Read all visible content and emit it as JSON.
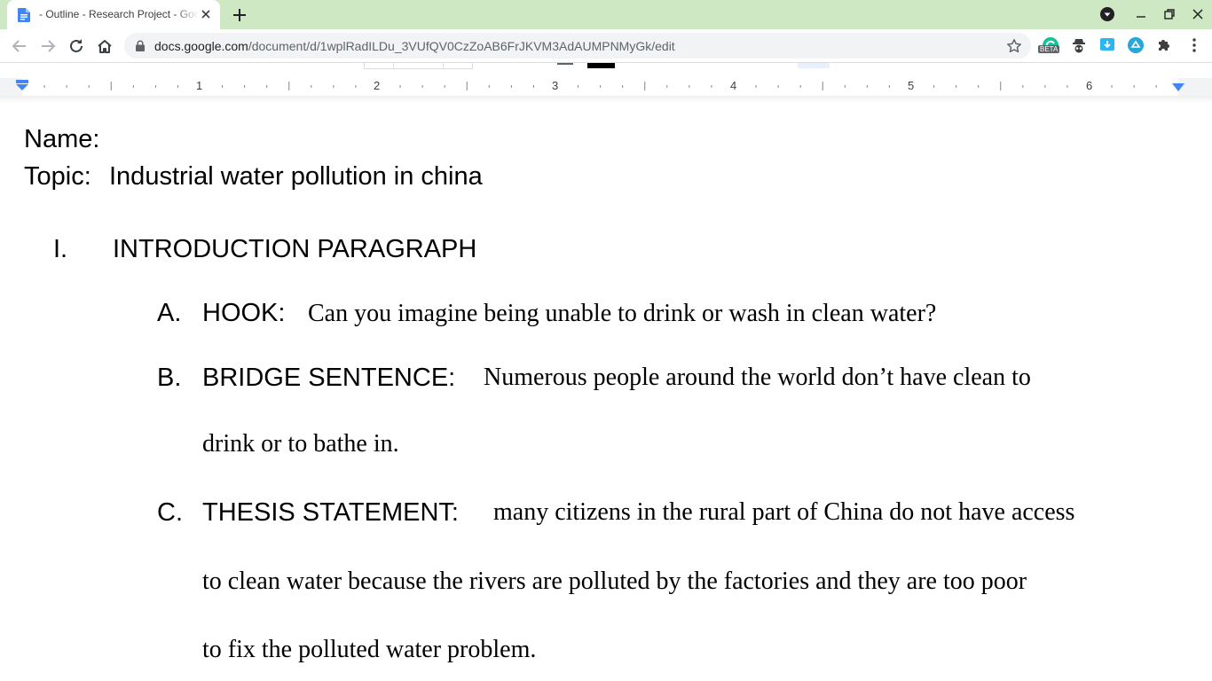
{
  "browser": {
    "tab_title": "- Outline - Research Project - Google Docs",
    "url_host": "docs.google.com",
    "url_path": "/document/d/1wplRadILDu_3VUfQV0CzZoAB6FrJKVM3AdAUMPNMyGk/edit",
    "extension_badge": "BETA"
  },
  "ruler": {
    "numbers": [
      "1",
      "2",
      "3",
      "4",
      "5",
      "6"
    ]
  },
  "document": {
    "name_label": "Name:",
    "topic_label": "Topic:",
    "topic_value": "Industrial water pollution in china",
    "section": {
      "numeral": "I.",
      "heading": "INTRODUCTION PARAGRAPH",
      "items": [
        {
          "letter": "A.",
          "label": "HOOK:",
          "lines": [
            "Can you imagine being unable to drink or wash in clean water?"
          ]
        },
        {
          "letter": "B.",
          "label": "BRIDGE SENTENCE:",
          "lines": [
            "Numerous people around the world don’t have clean to",
            "drink or to bathe in."
          ]
        },
        {
          "letter": "C.",
          "label": "THESIS STATEMENT:",
          "lines": [
            "many citizens in the rural part of China do not have access",
            "to clean water because the rivers are polluted by the factories and they are too poor",
            "to fix the polluted water problem."
          ]
        }
      ]
    }
  },
  "colors": {
    "tabstrip_bg": "#cde8c2",
    "docs_blue": "#4285f4",
    "omnibox_bg": "#f1f3f4"
  },
  "icons": [
    "docs-favicon-icon",
    "close-icon",
    "plus-icon",
    "profile-dropdown-icon",
    "minimize-icon",
    "restore-icon",
    "back-arrow-icon",
    "forward-arrow-icon",
    "reload-icon",
    "home-icon",
    "lock-icon",
    "star-icon",
    "extension-grammarly-icon",
    "extension-spy-icon",
    "extension-save-icon",
    "extension-circle-icon",
    "puzzle-icon",
    "kebab-menu-icon"
  ]
}
